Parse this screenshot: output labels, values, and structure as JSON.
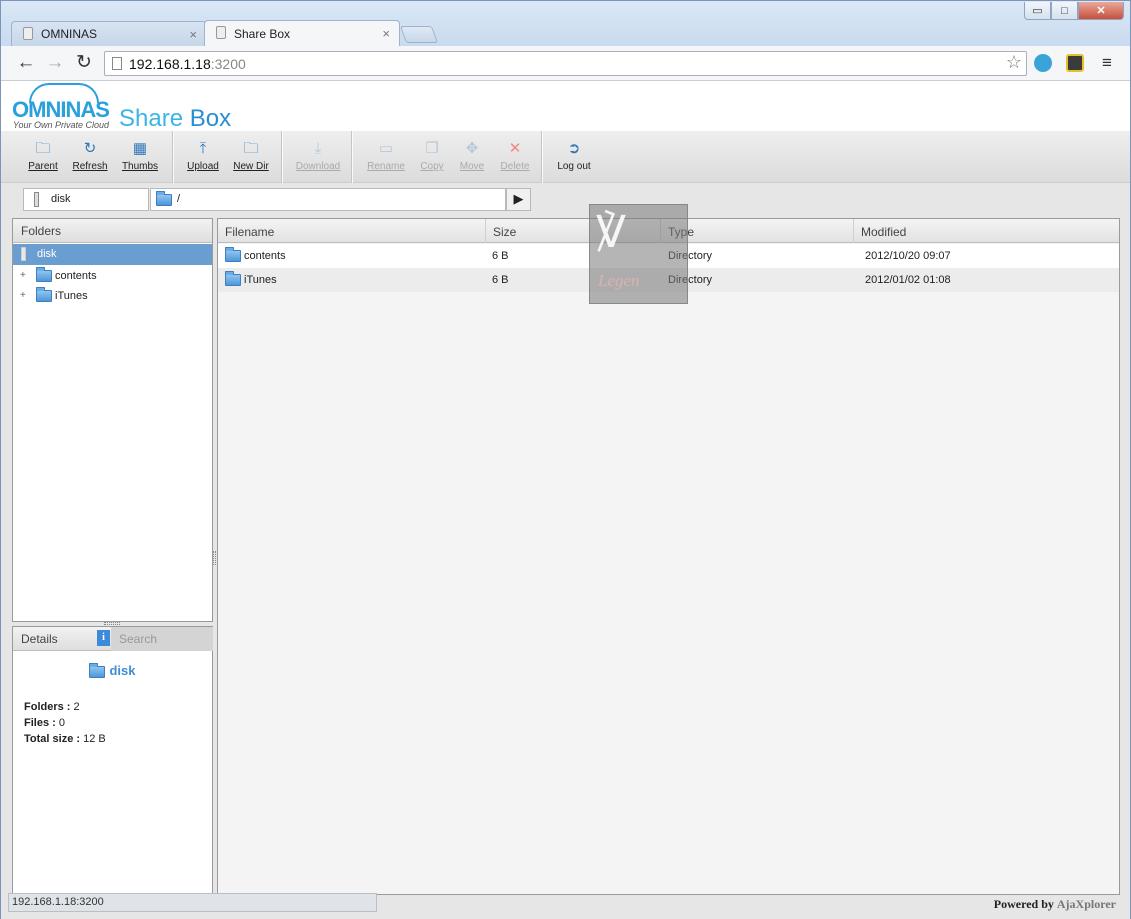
{
  "browser": {
    "tabs": [
      {
        "label": "OMNINAS",
        "active": false
      },
      {
        "label": "Share Box",
        "active": true
      }
    ],
    "url_host": "192.168.1.18",
    "url_port": ":3200",
    "window_controls": {
      "minimize": "▭",
      "maximize": "□",
      "close": "✕"
    }
  },
  "header": {
    "logo_text": "OMNINAS",
    "logo_tagline": "Your Own Private Cloud",
    "app_title_part1": "Share",
    "app_title_part2": " Box"
  },
  "toolbar": {
    "buttons": [
      {
        "label": "Parent",
        "icon": "parent-folder-icon",
        "enabled": true
      },
      {
        "label": "Refresh",
        "icon": "refresh-icon",
        "enabled": true
      },
      {
        "label": "Thumbs",
        "icon": "thumbs-grid-icon",
        "enabled": true
      },
      {
        "label": "Upload",
        "icon": "upload-icon",
        "enabled": true
      },
      {
        "label": "New Dir",
        "icon": "new-folder-icon",
        "enabled": true
      },
      {
        "label": "Download",
        "icon": "download-icon",
        "enabled": false
      },
      {
        "label": "Rename",
        "icon": "rename-icon",
        "enabled": false
      },
      {
        "label": "Copy",
        "icon": "copy-icon",
        "enabled": false
      },
      {
        "label": "Move",
        "icon": "move-icon",
        "enabled": false
      },
      {
        "label": "Delete",
        "icon": "delete-icon",
        "enabled": false
      },
      {
        "label": "Log out",
        "icon": "logout-icon",
        "enabled": true
      }
    ]
  },
  "location": {
    "repository": "disk",
    "path": "/"
  },
  "folders_pane": {
    "title": "Folders",
    "root": "disk",
    "children": [
      "contents",
      "iTunes"
    ]
  },
  "details_pane": {
    "tab_details": "Details",
    "tab_search": "Search",
    "selected": "disk",
    "folders_label": "Folders :",
    "folders_value": "2",
    "files_label": "Files :",
    "files_value": "0",
    "total_label": "Total size :",
    "total_value": "12 B"
  },
  "file_list": {
    "columns": [
      "Filename",
      "Size",
      "Type",
      "Modified"
    ],
    "rows": [
      {
        "name": "contents",
        "size": "6 B",
        "type": "Directory",
        "modified": "2012/10/20 09:07"
      },
      {
        "name": "iTunes",
        "size": "6 B",
        "type": "Directory",
        "modified": "2012/01/02 01:08"
      }
    ]
  },
  "statusbar": "192.168.1.18:3200",
  "footer": {
    "powered_prefix": "Powered by ",
    "powered_brand": "AjaXplorer"
  },
  "colors": {
    "accent": "#2aa0dc",
    "selection": "#6b9ed0"
  }
}
